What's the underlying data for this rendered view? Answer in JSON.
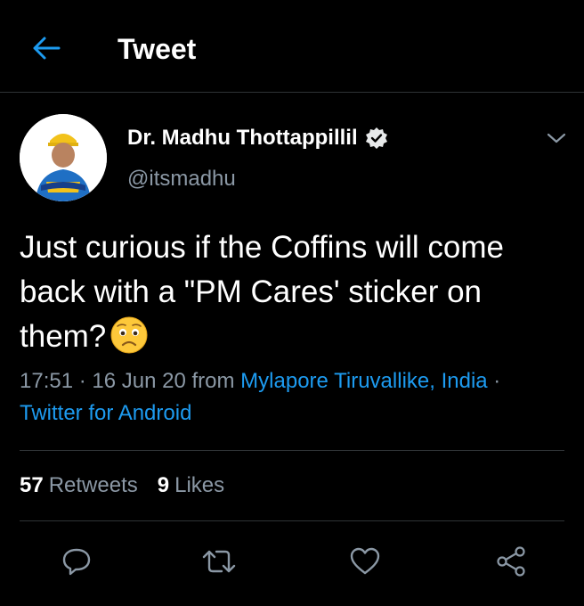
{
  "colors": {
    "background": "#000000",
    "accent": "#1d9bf0",
    "secondary_text": "#8b98a5",
    "divider": "#2f3336"
  },
  "header": {
    "back_icon": "arrow-left-icon",
    "title": "Tweet"
  },
  "author": {
    "name": "Dr. Madhu Thottappillil",
    "handle": "@itsmadhu",
    "verified_icon": "verified-badge-icon",
    "menu_icon": "chevron-down-icon"
  },
  "tweet": {
    "text": "Just curious if the Coffins will come back with a \"PM Cares' sticker on them?",
    "emoji": "worried-face-emoji"
  },
  "meta": {
    "time": "17:51",
    "date": "16 Jun 20",
    "from_word": "from",
    "location": "Mylapore Tiruvallike, India",
    "separator": "·",
    "source": "Twitter for Android"
  },
  "stats": {
    "retweets_count": "57",
    "retweets_label": "Retweets",
    "likes_count": "9",
    "likes_label": "Likes"
  },
  "actions": [
    {
      "icon": "reply-icon"
    },
    {
      "icon": "retweet-icon"
    },
    {
      "icon": "like-icon"
    },
    {
      "icon": "share-icon"
    }
  ]
}
